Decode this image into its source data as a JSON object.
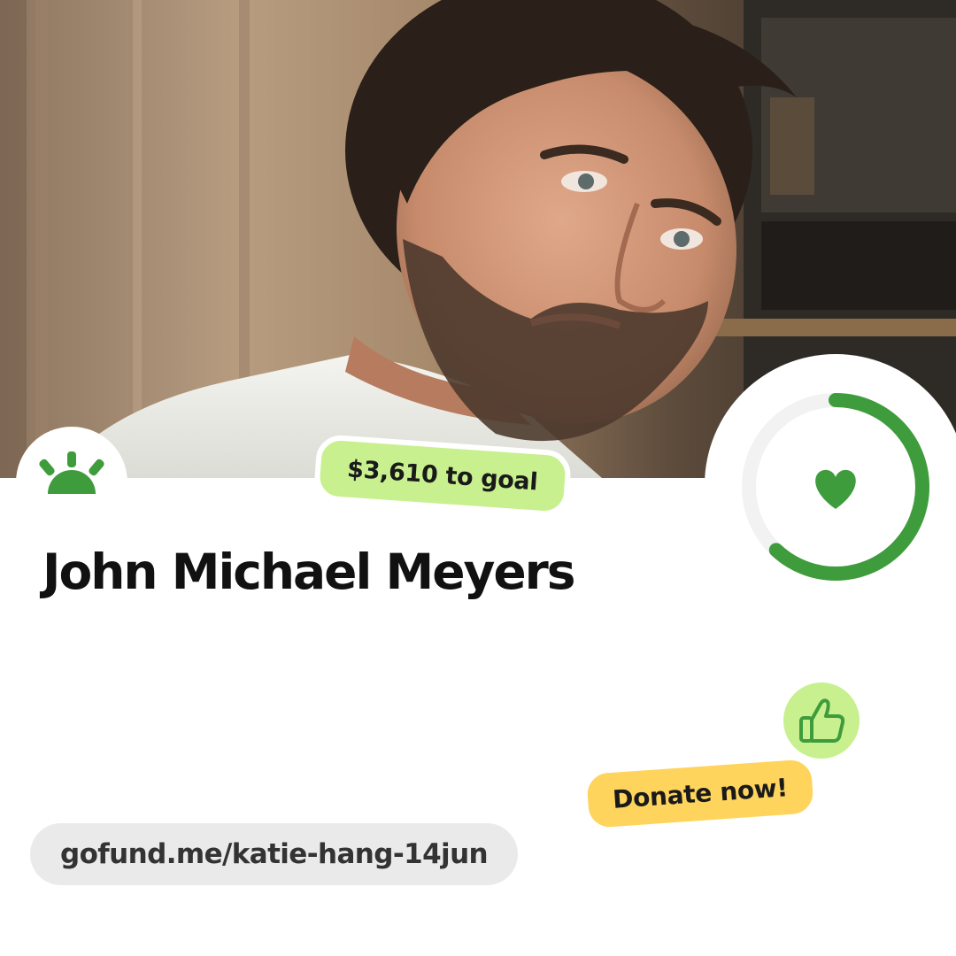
{
  "photo": {
    "subject": "portrait-photo"
  },
  "goal": {
    "label": "$3,610 to goal"
  },
  "fundraiser": {
    "title": "John Michael Meyers",
    "progress_fraction": 0.62
  },
  "actions": {
    "donate_label": "Donate now!"
  },
  "link": {
    "url": "gofund.me/katie-hang-14jun"
  },
  "icons": {
    "logo": "gofundme-sunrise-icon",
    "heart": "heart-icon",
    "thumb": "thumbs-up-icon"
  },
  "colors": {
    "brand_green": "#3f9c3c",
    "ring_track": "#f2f2f2",
    "goal_pill": "#c8f08f",
    "donate_pill": "#ffd45c",
    "url_pill": "#eaeaea",
    "title_text": "#111111"
  }
}
